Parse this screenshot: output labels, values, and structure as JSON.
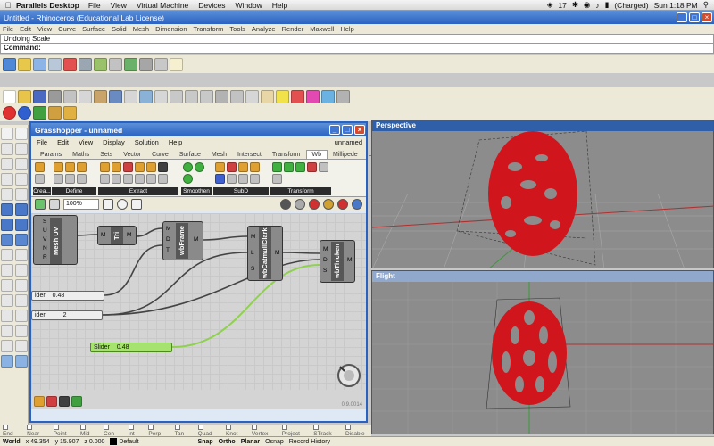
{
  "macbar": {
    "app": "Parallels Desktop",
    "menus": [
      "File",
      "View",
      "Virtual Machine",
      "Devices",
      "Window",
      "Help"
    ],
    "status": {
      "battery": "(Charged)",
      "clock": "Sun 1:18 PM",
      "notif": "17"
    }
  },
  "rhino": {
    "title": "Untitled - Rhinoceros (Educational Lab License)",
    "menus": [
      "File",
      "Edit",
      "View",
      "Curve",
      "Surface",
      "Solid",
      "Mesh",
      "Dimension",
      "Transform",
      "Tools",
      "Analyze",
      "Render",
      "Maxwell",
      "Help"
    ],
    "cmd_history": "Undoing Scale",
    "cmd_prompt": "Command:"
  },
  "grasshopper": {
    "title": "Grasshopper - unnamed",
    "menus": [
      "File",
      "Edit",
      "View",
      "Display",
      "Solution",
      "Help"
    ],
    "document": "unnamed",
    "tabs": [
      "Params",
      "Maths",
      "Sets",
      "Vector",
      "Curve",
      "Surface",
      "Mesh",
      "Intersect",
      "Transform",
      "Wb",
      "Millipede",
      "LunchBox"
    ],
    "active_tab": "Wb",
    "groups": [
      "Crea...",
      "Define",
      "Extract",
      "Smoothen",
      "SubD",
      "Transform"
    ],
    "zoom": "100%",
    "version": "0.9.0014",
    "components": {
      "meshuv": {
        "label": "Mesh UV",
        "inputs": [
          "S",
          "U",
          "V",
          "N",
          "R"
        ]
      },
      "tri": {
        "label": "Tri",
        "inputs": [
          "M"
        ],
        "outputs": [
          "M"
        ]
      },
      "wbframe": {
        "label": "wbFrame",
        "inputs": [
          "M",
          "D",
          "T"
        ],
        "outputs": [
          "M"
        ]
      },
      "catmull": {
        "label": "wbCatmullClark",
        "inputs": [
          "M",
          "L",
          "S"
        ],
        "outputs": [
          "M"
        ]
      },
      "thicken": {
        "label": "wbThicken",
        "inputs": [
          "M",
          "D",
          "S"
        ],
        "outputs": [
          "M"
        ]
      }
    },
    "sliders": [
      {
        "label": "ider",
        "value": "0.48"
      },
      {
        "label": "ider",
        "value": "2"
      },
      {
        "label": "Slider",
        "value": "0.48"
      }
    ]
  },
  "viewports": {
    "top": "Perspective",
    "bottom": "Flight"
  },
  "osnap": [
    "End",
    "Near",
    "Point",
    "Mid",
    "Cen",
    "Int",
    "Perp",
    "Tan",
    "Quad",
    "Knot",
    "Vertex",
    "Project",
    "STrack",
    "Disable"
  ],
  "status": {
    "cplane": "World",
    "x": "x 49.354",
    "y": "y 15.907",
    "z": "z 0.000",
    "layer": "Default",
    "toggles": [
      "Snap",
      "Ortho",
      "Planar",
      "Osnap",
      "Record History"
    ]
  },
  "colors": {
    "egg": "#d0161c",
    "gh_title": "#2a62c2",
    "wire_green": "#8fd14f"
  }
}
